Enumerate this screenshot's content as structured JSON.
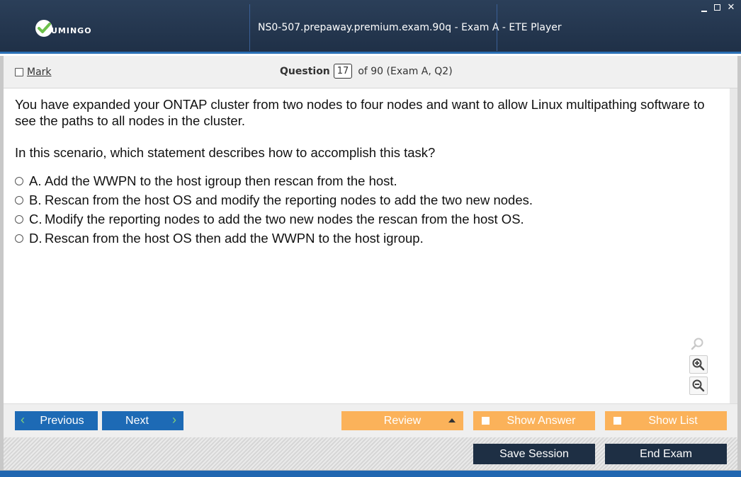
{
  "app": {
    "logo_text": "UMINGO",
    "window_title": "NS0-507.prepaway.premium.exam.90q - Exam A - ETE Player",
    "window_controls": [
      "minimize",
      "maximize",
      "close"
    ]
  },
  "header": {
    "mark_label": "Mark",
    "question_label": "Question",
    "question_number": "17",
    "question_suffix": "of 90 (Exam A, Q2)"
  },
  "question": {
    "text": "You have expanded your ONTAP cluster from two nodes to four nodes and want to allow Linux multipathing software to see the paths to all nodes in the cluster.",
    "prompt": "In this scenario, which statement describes how to accomplish this task?",
    "options": [
      {
        "letter": "A.",
        "text": "Add the WWPN to the host igroup then rescan from the host."
      },
      {
        "letter": "B.",
        "text": "Rescan from the host OS and modify the reporting nodes to add the two new nodes."
      },
      {
        "letter": "C.",
        "text": "Modify the reporting nodes to add the two new nodes the rescan from the host OS."
      },
      {
        "letter": "D.",
        "text": "Rescan from the host OS then add the WWPN to the host igroup."
      }
    ]
  },
  "zoom": {
    "icons": [
      "zoom-reset-icon",
      "zoom-in-icon",
      "zoom-out-icon"
    ]
  },
  "nav": {
    "previous": "Previous",
    "next": "Next",
    "review": "Review",
    "show_answer": "Show Answer",
    "show_list": "Show List"
  },
  "footer": {
    "save_session": "Save Session",
    "end_exam": "End Exam"
  },
  "colors": {
    "titlebar": "#1f3047",
    "accent_blue": "#1d6ab5",
    "orange": "#fbb25a",
    "dark_button": "#1e2f44",
    "logo_check": "#6cc04a"
  }
}
